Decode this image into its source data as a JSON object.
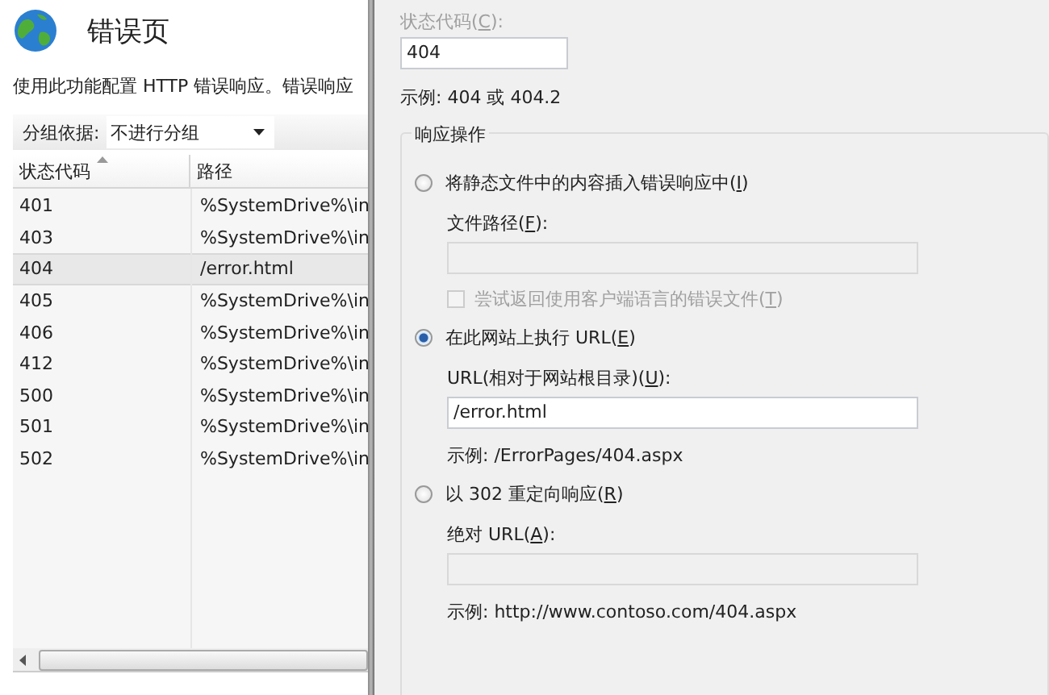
{
  "page": {
    "title": "错误页",
    "description": "使用此功能配置 HTTP 错误响应。错误响应"
  },
  "group_by": {
    "label": "分组依据:",
    "value": "不进行分组"
  },
  "table": {
    "columns": [
      "状态代码",
      "路径"
    ],
    "rows": [
      {
        "code": "401",
        "path": "%SystemDrive%\\in",
        "selected": false
      },
      {
        "code": "403",
        "path": "%SystemDrive%\\in",
        "selected": false
      },
      {
        "code": "404",
        "path": "/error.html",
        "selected": true
      },
      {
        "code": "405",
        "path": "%SystemDrive%\\in",
        "selected": false
      },
      {
        "code": "406",
        "path": "%SystemDrive%\\in",
        "selected": false
      },
      {
        "code": "412",
        "path": "%SystemDrive%\\in",
        "selected": false
      },
      {
        "code": "500",
        "path": "%SystemDrive%\\in",
        "selected": false
      },
      {
        "code": "501",
        "path": "%SystemDrive%\\in",
        "selected": false
      },
      {
        "code": "502",
        "path": "%SystemDrive%\\in",
        "selected": false
      }
    ]
  },
  "dialog": {
    "status_code": {
      "label": "状态代码(",
      "key": "C",
      "tail": "):",
      "value": "404",
      "disabled": true
    },
    "status_example": "示例: 404 或 404.2",
    "group_title": "响应操作",
    "options": [
      {
        "label": "将静态文件中的内容插入错误响应中(",
        "key": "I",
        "tail": ")",
        "selected": false,
        "field": {
          "label": "文件路径(",
          "key": "F",
          "tail": "):",
          "disabled": true
        },
        "checkbox": {
          "label": "尝试返回使用客户端语言的错误文件(",
          "key": "T",
          "tail": ")",
          "checked": false,
          "disabled": true
        }
      },
      {
        "label": "在此网站上执行 URL(",
        "key": "E",
        "tail": ")",
        "selected": true,
        "field": {
          "label": "URL(相对于网站根目录)(",
          "key": "U",
          "tail": "):",
          "value": "/error.html",
          "disabled": false
        },
        "example": "示例: /ErrorPages/404.aspx"
      },
      {
        "label": "以 302 重定向响应(",
        "key": "R",
        "tail": ")",
        "selected": false,
        "field": {
          "label": "绝对 URL(",
          "key": "A",
          "tail": "):",
          "disabled": true
        },
        "example": "示例: http://www.contoso.com/404.aspx"
      }
    ]
  }
}
